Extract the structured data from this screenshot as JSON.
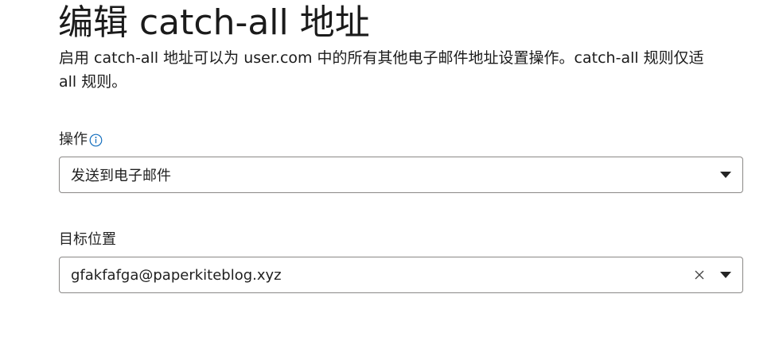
{
  "header": {
    "title": "编辑 catch-all 地址",
    "description_line1": "启用 catch-all 地址可以为 user.com 中的所有其他电子邮件地址设置操作。catch-all 规则仅适",
    "description_line2": "all 规则。"
  },
  "action": {
    "label": "操作",
    "info_icon": "info-icon",
    "selected_value": "发送到电子邮件",
    "dropdown_icon": "chevron-down-icon"
  },
  "target": {
    "label": "目标位置",
    "value": "gfakfafga@paperkiteblog.xyz",
    "clear_icon": "close-icon",
    "dropdown_icon": "chevron-down-icon"
  }
}
